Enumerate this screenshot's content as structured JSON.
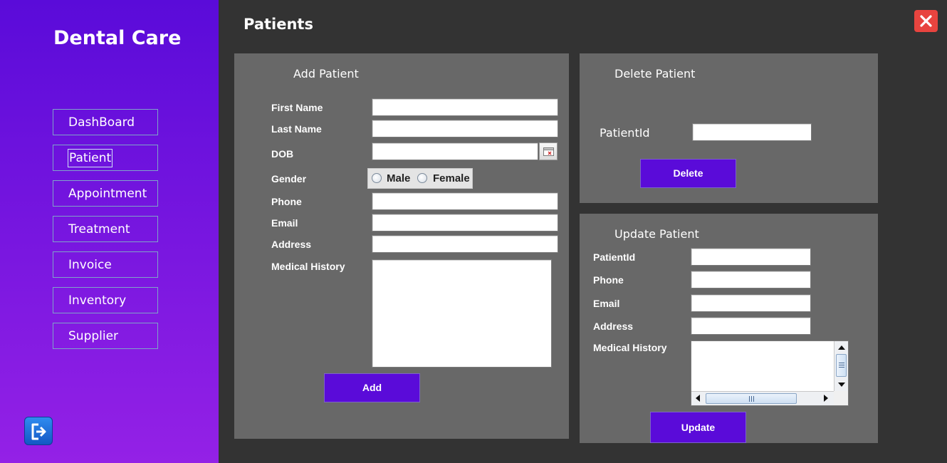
{
  "sidebar": {
    "brand": "Dental Care",
    "items": [
      {
        "label": "DashBoard"
      },
      {
        "label": "Patient"
      },
      {
        "label": "Appointment"
      },
      {
        "label": "Treatment"
      },
      {
        "label": "Invoice"
      },
      {
        "label": "Inventory"
      },
      {
        "label": "Supplier"
      }
    ],
    "active": "Patient",
    "logout_icon": "logout-icon"
  },
  "header": {
    "title": "Patients",
    "close_icon": "close-icon",
    "close_color": "#e8443f"
  },
  "add_panel": {
    "title": "Add Patient",
    "labels": {
      "first_name": "First Name",
      "last_name": "Last Name",
      "dob": "DOB",
      "gender": "Gender",
      "phone": "Phone",
      "email": "Email",
      "address": "Address",
      "medical_history": "Medical History"
    },
    "values": {
      "first_name": "",
      "last_name": "",
      "dob": "",
      "phone": "",
      "email": "",
      "address": "",
      "medical_history": ""
    },
    "gender_options": [
      "Male",
      "Female"
    ],
    "add_label": "Add",
    "calendar_icon": "calendar-icon"
  },
  "delete_panel": {
    "title": "Delete Patient",
    "patient_id_label": "PatientId",
    "patient_id_value": "",
    "delete_label": "Delete"
  },
  "update_panel": {
    "title": "Update Patient",
    "labels": {
      "patient_id": "PatientId",
      "phone": "Phone",
      "email": "Email",
      "address": "Address",
      "medical_history": "Medical History"
    },
    "values": {
      "patient_id": "",
      "phone": "",
      "email": "",
      "address": "",
      "medical_history": ""
    },
    "update_label": "Update"
  },
  "colors": {
    "accent": "#5a0bd9",
    "panel": "#686868",
    "background": "#333333"
  }
}
